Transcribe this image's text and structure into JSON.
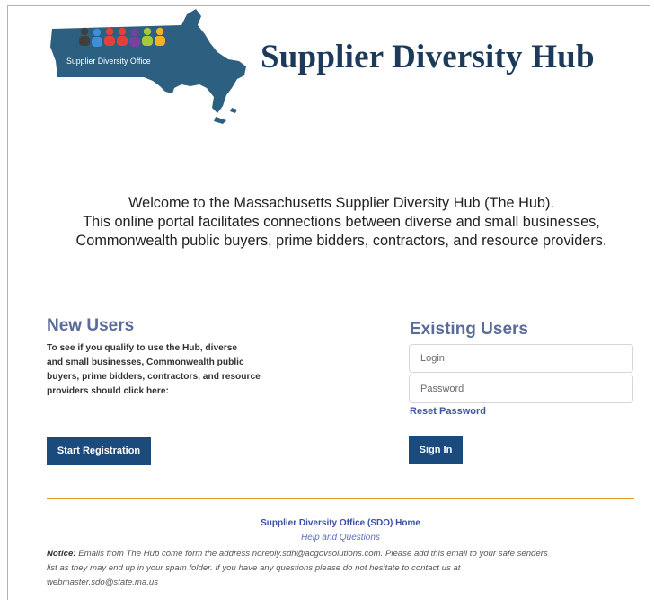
{
  "header": {
    "logo_text": "Supplier Diversity Office",
    "title": "Supplier Diversity Hub"
  },
  "welcome": {
    "line1": "Welcome to the Massachusetts Supplier Diversity Hub (The Hub).",
    "line2": "This online portal facilitates connections between diverse and small businesses,",
    "line3": "Commonwealth public buyers, prime bidders, contractors, and resource providers."
  },
  "new_users": {
    "title": "New Users",
    "desc_line1": "To see if you qualify to use the Hub, diverse",
    "desc_line2": "and small businesses, Commonwealth public",
    "desc_line3": "buyers, prime bidders, contractors, and resource",
    "desc_line4": "providers should click here:",
    "button_label": "Start Registration"
  },
  "existing_users": {
    "title": "Existing Users",
    "login_placeholder": "Login",
    "password_placeholder": "Password",
    "reset_label": "Reset Password",
    "signin_label": "Sign In"
  },
  "footer": {
    "sdo_home": "Supplier Diversity Office (SDO) Home",
    "help": "Help and Questions",
    "notice_label": "Notice:",
    "notice_line1": "Emails from The Hub come form the address noreply.sdh@acgovsolutions.com. Please add this email to your safe senders",
    "notice_line2": "list as they may end up in your spam folder. If you have any questions please do not hesitate to contact us at",
    "notice_line3": "webmaster.sdo@state.ma.us"
  },
  "colors": {
    "brand_navy": "#1c3b5a",
    "button": "#1b4a7c",
    "section_title": "#5b6b9a",
    "rule": "#e69a2e",
    "link": "#3a4fa3"
  }
}
